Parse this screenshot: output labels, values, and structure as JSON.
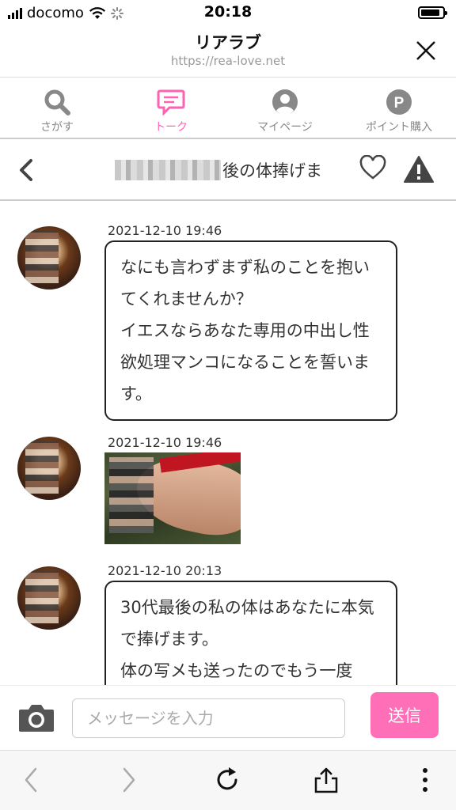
{
  "status_bar": {
    "carrier": "docomo",
    "time": "20:18"
  },
  "browser": {
    "title": "リアラブ",
    "url": "https://rea-love.net"
  },
  "tabs": [
    {
      "label": "さがす",
      "icon": "search-icon"
    },
    {
      "label": "トーク",
      "icon": "chat-icon",
      "active": true
    },
    {
      "label": "マイページ",
      "icon": "user-icon"
    },
    {
      "label": "ポイント購入",
      "icon": "point-icon"
    }
  ],
  "chat": {
    "partner_name_visible": "後の体捧げま"
  },
  "messages": [
    {
      "timestamp": "2021-12-10 19:46",
      "text": "なにも言わずまず私のことを抱いてくれませんか？\nイエスならあなた専用の中出し性欲処理マンコになることを誓います。"
    },
    {
      "timestamp": "2021-12-10 19:46",
      "type": "image"
    },
    {
      "timestamp": "2021-12-10 20:13",
      "text": "30代最後の私の体はあなたに本気で捧げます。\n体の写メも送ったのでもう一度"
    }
  ],
  "composer": {
    "placeholder": "メッセージを入力",
    "send_label": "送信"
  },
  "colors": {
    "accent": "#ff62b4",
    "send_button": "#ff6fb8",
    "tab_inactive": "#888888"
  }
}
